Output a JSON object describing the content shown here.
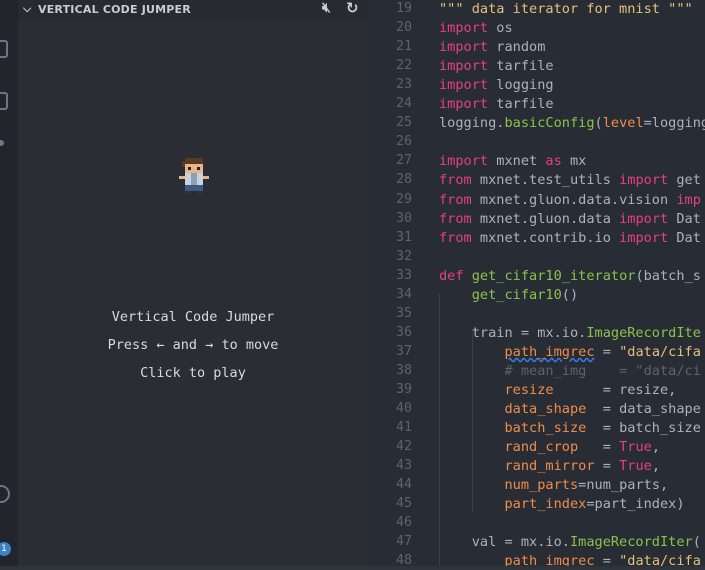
{
  "panel": {
    "title": "VERTICAL CODE JUMPER",
    "mute_icon": "speaker-mute-icon",
    "reload_icon": "reload-icon"
  },
  "game": {
    "line1": "Vertical Code Jumper",
    "line2": "Press ← and → to move",
    "line3": "Click to play"
  },
  "activity_bar": {
    "badge": "1"
  },
  "editor": {
    "lines": [
      {
        "n": "19",
        "segs": [
          [
            "str",
            "\"\"\" data iterator for mnist \"\"\""
          ]
        ]
      },
      {
        "n": "20",
        "segs": [
          [
            "kw",
            "import"
          ],
          [
            "txt",
            " os"
          ]
        ]
      },
      {
        "n": "21",
        "segs": [
          [
            "kw",
            "import"
          ],
          [
            "txt",
            " random"
          ]
        ]
      },
      {
        "n": "22",
        "segs": [
          [
            "kw",
            "import"
          ],
          [
            "txt",
            " tarfile"
          ]
        ]
      },
      {
        "n": "23",
        "segs": [
          [
            "kw",
            "import"
          ],
          [
            "txt",
            " logging"
          ]
        ]
      },
      {
        "n": "24",
        "segs": [
          [
            "kw",
            "import"
          ],
          [
            "txt",
            " tarfile"
          ]
        ]
      },
      {
        "n": "25",
        "segs": [
          [
            "txt",
            "logging."
          ],
          [
            "fn",
            "basicConfig"
          ],
          [
            "txt",
            "("
          ],
          [
            "param",
            "level"
          ],
          [
            "txt",
            "=logging"
          ]
        ]
      },
      {
        "n": "26",
        "segs": []
      },
      {
        "n": "27",
        "segs": [
          [
            "kw",
            "import"
          ],
          [
            "txt",
            " mxnet "
          ],
          [
            "kw",
            "as"
          ],
          [
            "txt",
            " mx"
          ]
        ]
      },
      {
        "n": "28",
        "segs": [
          [
            "kw",
            "from"
          ],
          [
            "txt",
            " mxnet.test_utils "
          ],
          [
            "kw",
            "import"
          ],
          [
            "txt",
            " get"
          ]
        ]
      },
      {
        "n": "29",
        "segs": [
          [
            "kw",
            "from"
          ],
          [
            "txt",
            " mxnet.gluon.data.vision "
          ],
          [
            "kw",
            "imp"
          ]
        ]
      },
      {
        "n": "30",
        "segs": [
          [
            "kw",
            "from"
          ],
          [
            "txt",
            " mxnet.gluon.data "
          ],
          [
            "kw",
            "import"
          ],
          [
            "txt",
            " Dat"
          ]
        ]
      },
      {
        "n": "31",
        "segs": [
          [
            "kw",
            "from"
          ],
          [
            "txt",
            " mxnet.contrib.io "
          ],
          [
            "kw",
            "import"
          ],
          [
            "txt",
            " Dat"
          ]
        ]
      },
      {
        "n": "32",
        "segs": []
      },
      {
        "n": "33",
        "segs": [
          [
            "kw",
            "def"
          ],
          [
            "txt",
            " "
          ],
          [
            "fn",
            "get_cifar10_iterator"
          ],
          [
            "txt",
            "(batch_s"
          ]
        ]
      },
      {
        "n": "34",
        "segs": [
          [
            "txt",
            "    "
          ],
          [
            "fn",
            "get_cifar10"
          ],
          [
            "txt",
            "()"
          ]
        ]
      },
      {
        "n": "35",
        "segs": []
      },
      {
        "n": "36",
        "segs": [
          [
            "txt",
            "    train = mx.io."
          ],
          [
            "fn",
            "ImageRecordIte"
          ]
        ]
      },
      {
        "n": "37",
        "segs": [
          [
            "txt",
            "        "
          ],
          [
            "param",
            "path_imgrec"
          ],
          [
            "txt",
            " = "
          ],
          [
            "str",
            "\"data/cifa"
          ]
        ]
      },
      {
        "n": "38",
        "segs": [
          [
            "txt",
            "        "
          ],
          [
            "cmt",
            "# mean_img    = \"data/ci"
          ]
        ]
      },
      {
        "n": "39",
        "segs": [
          [
            "txt",
            "        "
          ],
          [
            "param",
            "resize"
          ],
          [
            "txt",
            "      = resize,"
          ]
        ]
      },
      {
        "n": "40",
        "segs": [
          [
            "txt",
            "        "
          ],
          [
            "param",
            "data_shape"
          ],
          [
            "txt",
            "  = data_shape"
          ]
        ]
      },
      {
        "n": "41",
        "segs": [
          [
            "txt",
            "        "
          ],
          [
            "param",
            "batch_size"
          ],
          [
            "txt",
            "  = batch_size"
          ]
        ]
      },
      {
        "n": "42",
        "segs": [
          [
            "txt",
            "        "
          ],
          [
            "param",
            "rand_crop"
          ],
          [
            "txt",
            "   = "
          ],
          [
            "bool",
            "True"
          ],
          [
            "txt",
            ","
          ]
        ]
      },
      {
        "n": "43",
        "segs": [
          [
            "txt",
            "        "
          ],
          [
            "param",
            "rand_mirror"
          ],
          [
            "txt",
            " = "
          ],
          [
            "bool",
            "True"
          ],
          [
            "txt",
            ","
          ]
        ]
      },
      {
        "n": "44",
        "segs": [
          [
            "txt",
            "        "
          ],
          [
            "param",
            "num_parts"
          ],
          [
            "txt",
            "=num_parts,"
          ]
        ]
      },
      {
        "n": "45",
        "segs": [
          [
            "txt",
            "        "
          ],
          [
            "param",
            "part_index"
          ],
          [
            "txt",
            "=part_index)"
          ]
        ]
      },
      {
        "n": "46",
        "segs": []
      },
      {
        "n": "47",
        "segs": [
          [
            "txt",
            "    val = mx.io."
          ],
          [
            "fn",
            "ImageRecordIter"
          ],
          [
            "txt",
            "("
          ]
        ]
      },
      {
        "n": "48",
        "segs": [
          [
            "txt",
            "        "
          ],
          [
            "param",
            "path_imgrec"
          ],
          [
            "txt",
            " = "
          ],
          [
            "str",
            "\"data/cifa"
          ]
        ]
      }
    ]
  }
}
